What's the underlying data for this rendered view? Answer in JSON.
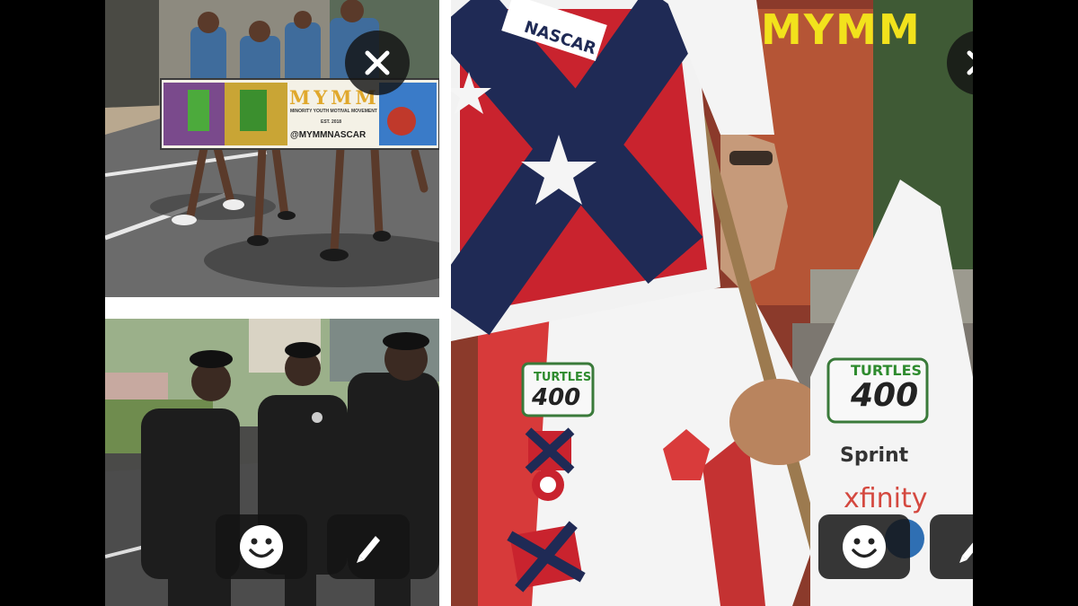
{
  "story": {
    "left_top_photo": {
      "banner_title": "MYMM",
      "banner_subtitle": "MINORITY YOUTH MOTIVAL MOVEMENT",
      "banner_est": "EST. 2018",
      "banner_handle": "@MYMMNASCAR",
      "close_icon": "close-icon"
    },
    "left_bottom_photo": {
      "emoji_icon": "smiley-icon",
      "pencil_icon": "pencil-icon"
    },
    "right_photo": {
      "sticker_text": "MYMM",
      "flag_brand": "NASCAR",
      "patch_line1": "TURTLES",
      "patch_line2": "400",
      "sponsor_sprint": "Sprint",
      "sponsor_xfinity": "xfinity",
      "close_icon": "close-icon",
      "emoji_icon": "smiley-icon",
      "pencil_icon": "pencil-icon"
    }
  },
  "colors": {
    "overlay_bg": "#141414",
    "sticker_yellow": "#f2e21c",
    "page_bg": "#000000",
    "divider": "#ffffff"
  }
}
